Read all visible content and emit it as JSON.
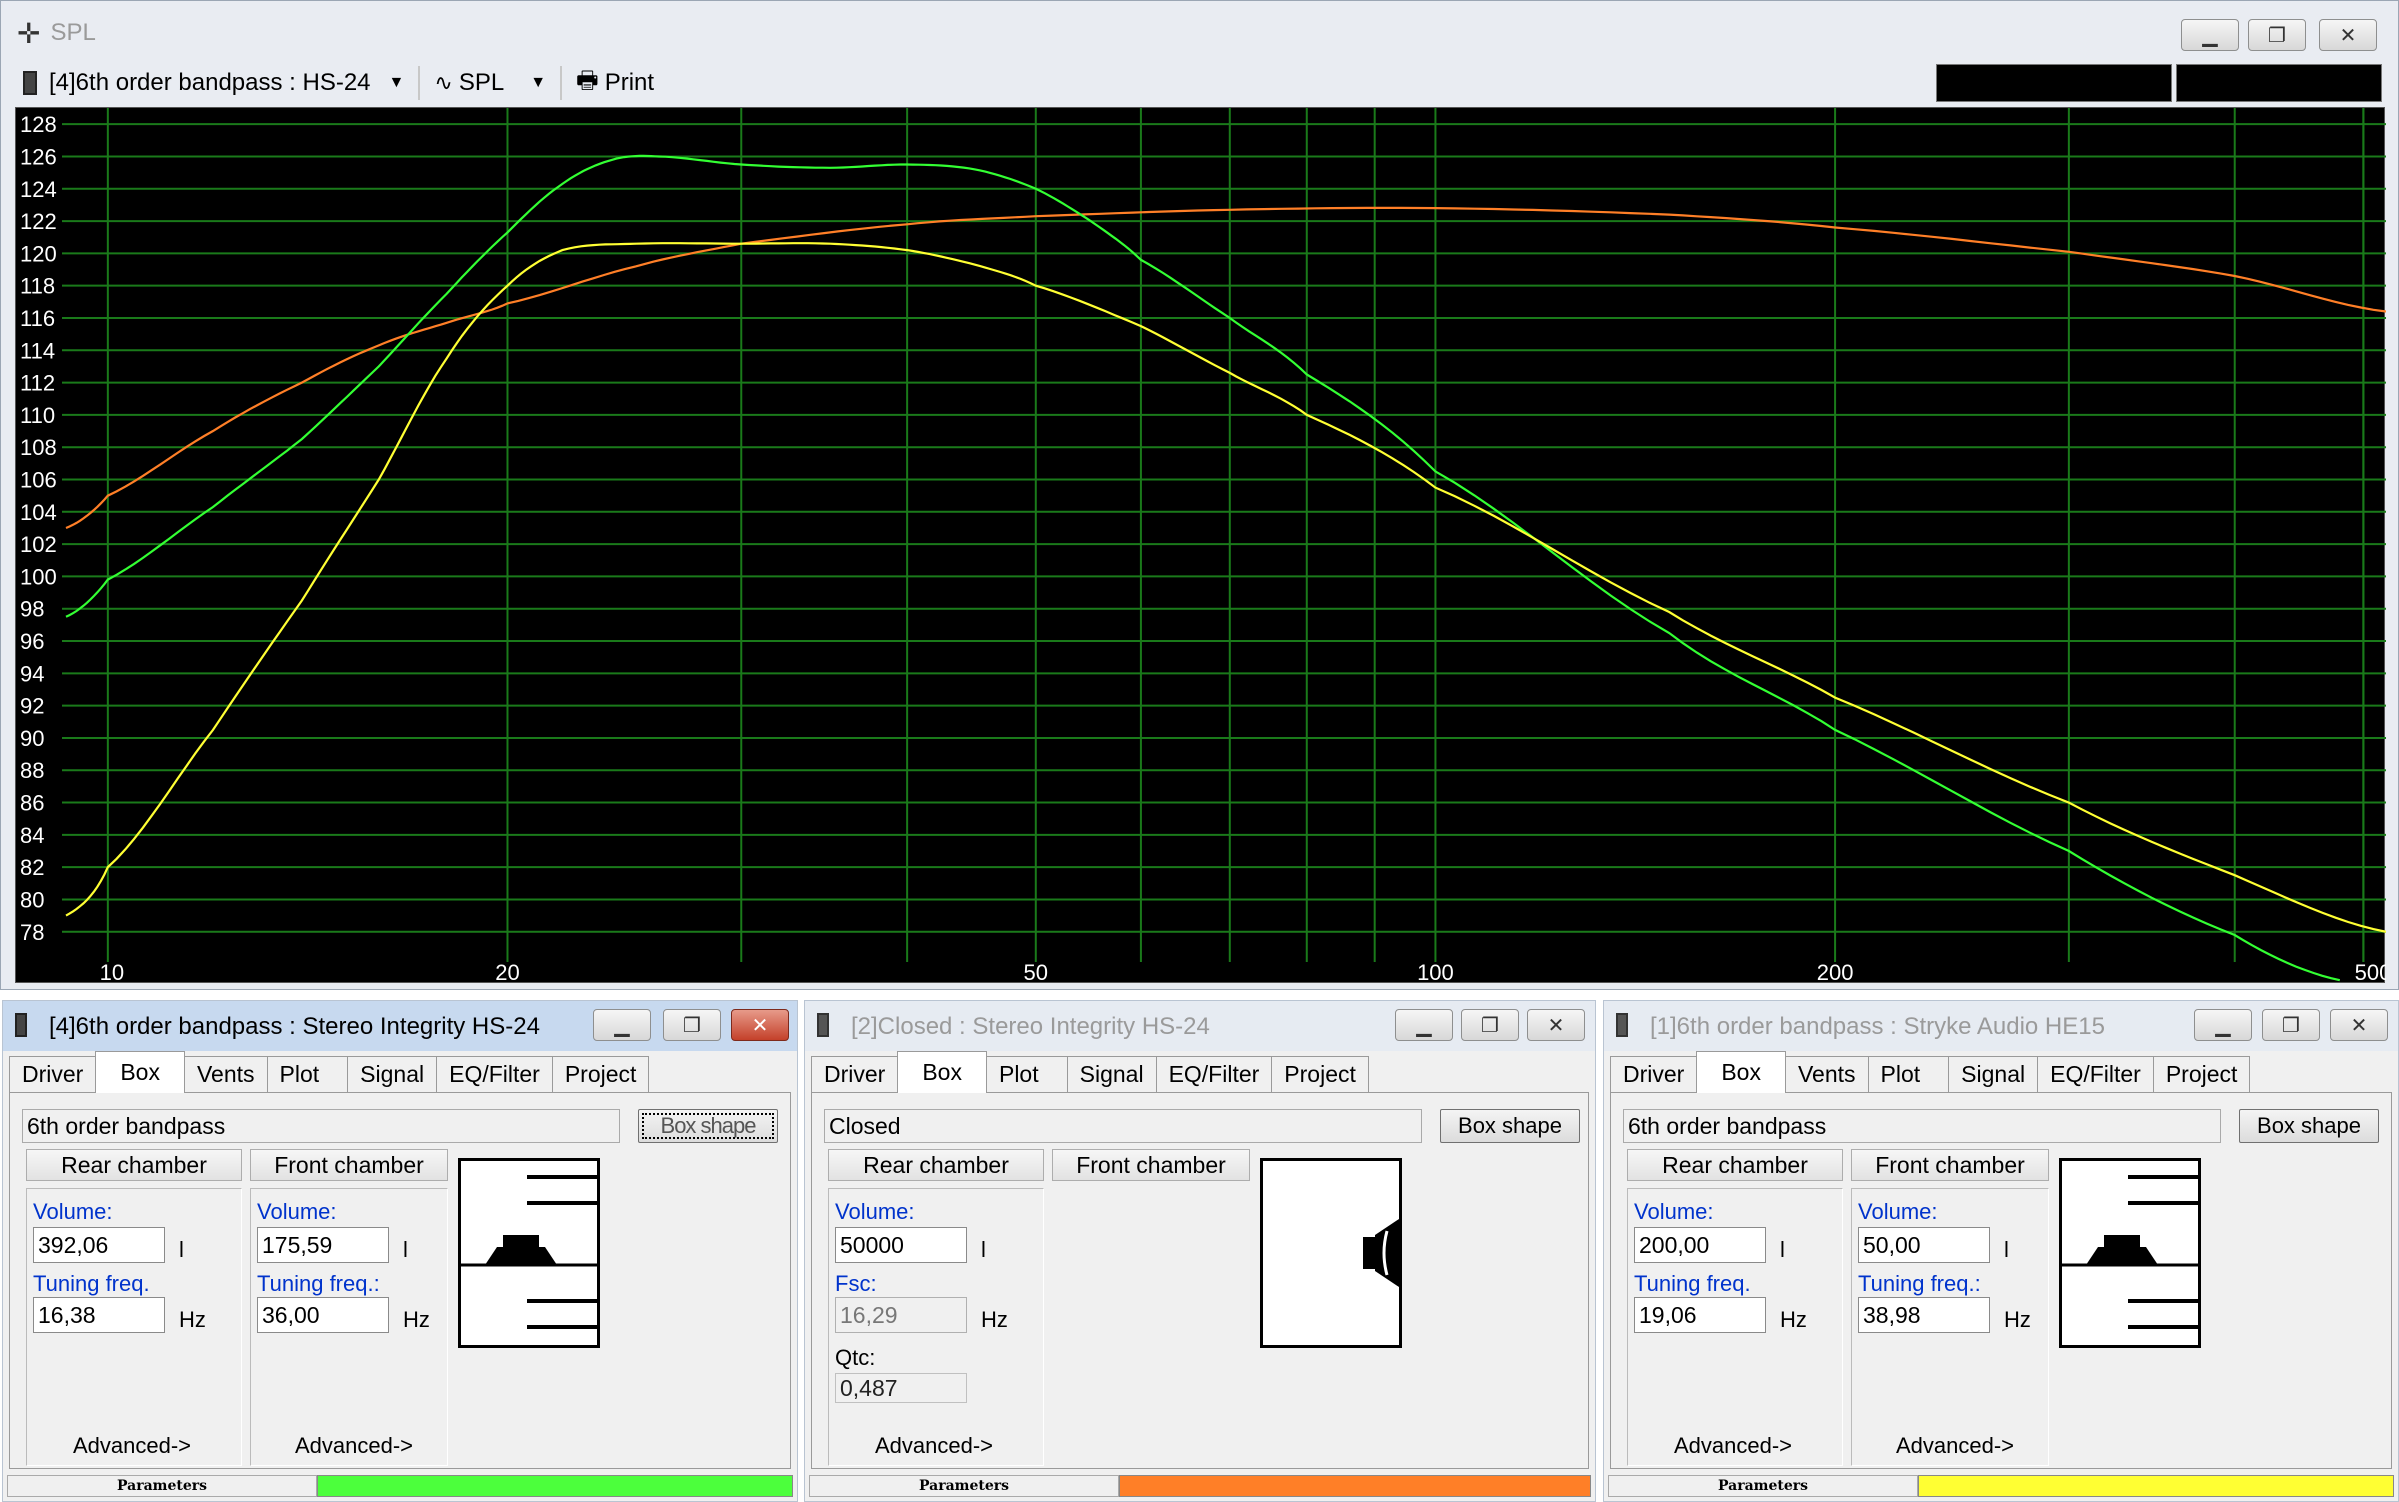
{
  "spl_window": {
    "title": "SPL",
    "toolbar": {
      "project_select": "[4]6th order bandpass : HS-24",
      "graph_select": "SPL",
      "print_label": "Print"
    }
  },
  "chart_data": {
    "type": "line",
    "x_scale": "log",
    "xlim": [
      9.3,
      520
    ],
    "ylim": [
      76.5,
      129
    ],
    "x_ticks": [
      10,
      20,
      50,
      100,
      200,
      500
    ],
    "x_tick_labels": [
      "10",
      "20",
      "50",
      "100",
      "200",
      "500"
    ],
    "y_ticks": [
      78,
      80,
      82,
      84,
      86,
      88,
      90,
      92,
      94,
      96,
      98,
      100,
      102,
      104,
      106,
      108,
      110,
      112,
      114,
      116,
      118,
      120,
      122,
      124,
      126,
      128
    ],
    "grid": true,
    "background": "#000000",
    "grid_color": "#1a7a1a",
    "series": [
      {
        "color": "#ff7f27",
        "points": [
          [
            9.3,
            103
          ],
          [
            10,
            105
          ],
          [
            12,
            109
          ],
          [
            14,
            112
          ],
          [
            16,
            114.3
          ],
          [
            18,
            115.7
          ],
          [
            20,
            116.9
          ],
          [
            25,
            119.2
          ],
          [
            30,
            120.6
          ],
          [
            40,
            121.8
          ],
          [
            50,
            122.3
          ],
          [
            70,
            122.7
          ],
          [
            100,
            122.8
          ],
          [
            150,
            122.4
          ],
          [
            200,
            121.6
          ],
          [
            300,
            120.1
          ],
          [
            400,
            118.6
          ],
          [
            520,
            116.4
          ]
        ]
      },
      {
        "color": "#33ff33",
        "points": [
          [
            9.3,
            97.5
          ],
          [
            10,
            99.8
          ],
          [
            12,
            104.3
          ],
          [
            14,
            108.5
          ],
          [
            16,
            113
          ],
          [
            18,
            117.5
          ],
          [
            20,
            121.3
          ],
          [
            22,
            124.3
          ],
          [
            24,
            125.8
          ],
          [
            26,
            126
          ],
          [
            30,
            125.5
          ],
          [
            35,
            125.3
          ],
          [
            40,
            125.5
          ],
          [
            45,
            125.2
          ],
          [
            50,
            124
          ],
          [
            55,
            122
          ],
          [
            60,
            119.6
          ],
          [
            70,
            116
          ],
          [
            80,
            112.5
          ],
          [
            100,
            106.5
          ],
          [
            150,
            96.5
          ],
          [
            200,
            90.5
          ],
          [
            300,
            83
          ],
          [
            400,
            77.8
          ],
          [
            480,
            75
          ]
        ]
      },
      {
        "color": "#ffff33",
        "points": [
          [
            9.3,
            79
          ],
          [
            10,
            82
          ],
          [
            12,
            90.5
          ],
          [
            14,
            98.5
          ],
          [
            16,
            106
          ],
          [
            18,
            113.5
          ],
          [
            20,
            118
          ],
          [
            22,
            120.2
          ],
          [
            25,
            120.6
          ],
          [
            30,
            120.6
          ],
          [
            35,
            120.6
          ],
          [
            40,
            120.2
          ],
          [
            45,
            119.3
          ],
          [
            50,
            118
          ],
          [
            60,
            115.5
          ],
          [
            70,
            112.6
          ],
          [
            80,
            110
          ],
          [
            100,
            105.5
          ],
          [
            150,
            97.8
          ],
          [
            200,
            92.5
          ],
          [
            300,
            86
          ],
          [
            400,
            81.5
          ],
          [
            520,
            78
          ]
        ]
      }
    ]
  },
  "panels": [
    {
      "title": "[4]6th order bandpass : Stereo Integrity HS-24",
      "active": true,
      "tabs": [
        "Driver",
        "Box",
        "Vents",
        "Plot",
        "Signal",
        "EQ/Filter",
        "Project"
      ],
      "box_type": "6th order bandpass",
      "box_shape_btn": "Box shape",
      "rear_chamber_btn": "Rear chamber",
      "front_chamber_btn": "Front chamber",
      "rear": {
        "volume_label": "Volume:",
        "volume": "392,06",
        "volume_unit": "l",
        "freq_label": "Tuning freq.",
        "freq": "16,38",
        "freq_unit": "Hz",
        "advanced": "Advanced->"
      },
      "front": {
        "volume_label": "Volume:",
        "volume": "175,59",
        "volume_unit": "l",
        "freq_label": "Tuning freq.:",
        "freq": "36,00",
        "freq_unit": "Hz",
        "advanced": "Advanced->"
      },
      "params_label": "Parameters",
      "status_color": "#4cff3c"
    },
    {
      "title": "[2]Closed : Stereo Integrity HS-24",
      "active": false,
      "tabs": [
        "Driver",
        "Box",
        "Plot",
        "Signal",
        "EQ/Filter",
        "Project"
      ],
      "box_type": "Closed",
      "box_shape_btn": "Box shape",
      "rear_chamber_btn": "Rear chamber",
      "front_chamber_btn": "Front chamber",
      "rear": {
        "volume_label": "Volume:",
        "volume": "50000",
        "volume_unit": "l",
        "fsc_label": "Fsc:",
        "fsc": "16,29",
        "fsc_unit": "Hz",
        "qtc_label": "Qtc:",
        "qtc": "0,487",
        "advanced": "Advanced->"
      },
      "params_label": "Parameters",
      "status_color": "#ff7f27"
    },
    {
      "title": "[1]6th order bandpass : Stryke Audio HE15",
      "active": false,
      "tabs": [
        "Driver",
        "Box",
        "Vents",
        "Plot",
        "Signal",
        "EQ/Filter",
        "Project"
      ],
      "box_type": "6th order bandpass",
      "box_shape_btn": "Box shape",
      "rear_chamber_btn": "Rear chamber",
      "front_chamber_btn": "Front chamber",
      "rear": {
        "volume_label": "Volume:",
        "volume": "200,00",
        "volume_unit": "l",
        "freq_label": "Tuning freq.",
        "freq": "19,06",
        "freq_unit": "Hz",
        "advanced": "Advanced->"
      },
      "front": {
        "volume_label": "Volume:",
        "volume": "50,00",
        "volume_unit": "l",
        "freq_label": "Tuning freq.:",
        "freq": "38,98",
        "freq_unit": "Hz",
        "advanced": "Advanced->"
      },
      "params_label": "Parameters",
      "status_color": "#ffff33"
    }
  ]
}
